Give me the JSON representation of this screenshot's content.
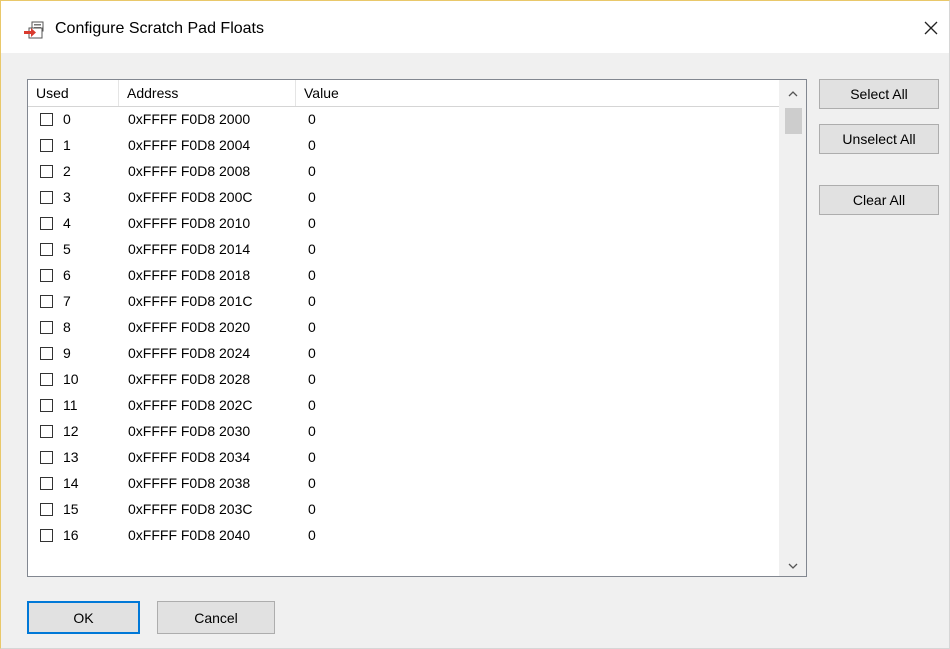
{
  "window": {
    "title": "Configure Scratch Pad Floats",
    "icon": "scratch-pad-icon",
    "close_label": "×"
  },
  "table": {
    "columns": [
      "Used",
      "Address",
      "Value"
    ],
    "rows": [
      {
        "index": "0",
        "address": "0xFFFF F0D8 2000",
        "value": "0",
        "checked": false
      },
      {
        "index": "1",
        "address": "0xFFFF F0D8 2004",
        "value": "0",
        "checked": false
      },
      {
        "index": "2",
        "address": "0xFFFF F0D8 2008",
        "value": "0",
        "checked": false
      },
      {
        "index": "3",
        "address": "0xFFFF F0D8 200C",
        "value": "0",
        "checked": false
      },
      {
        "index": "4",
        "address": "0xFFFF F0D8 2010",
        "value": "0",
        "checked": false
      },
      {
        "index": "5",
        "address": "0xFFFF F0D8 2014",
        "value": "0",
        "checked": false
      },
      {
        "index": "6",
        "address": "0xFFFF F0D8 2018",
        "value": "0",
        "checked": false
      },
      {
        "index": "7",
        "address": "0xFFFF F0D8 201C",
        "value": "0",
        "checked": false
      },
      {
        "index": "8",
        "address": "0xFFFF F0D8 2020",
        "value": "0",
        "checked": false
      },
      {
        "index": "9",
        "address": "0xFFFF F0D8 2024",
        "value": "0",
        "checked": false
      },
      {
        "index": "10",
        "address": "0xFFFF F0D8 2028",
        "value": "0",
        "checked": false
      },
      {
        "index": "11",
        "address": "0xFFFF F0D8 202C",
        "value": "0",
        "checked": false
      },
      {
        "index": "12",
        "address": "0xFFFF F0D8 2030",
        "value": "0",
        "checked": false
      },
      {
        "index": "13",
        "address": "0xFFFF F0D8 2034",
        "value": "0",
        "checked": false
      },
      {
        "index": "14",
        "address": "0xFFFF F0D8 2038",
        "value": "0",
        "checked": false
      },
      {
        "index": "15",
        "address": "0xFFFF F0D8 203C",
        "value": "0",
        "checked": false
      },
      {
        "index": "16",
        "address": "0xFFFF F0D8 2040",
        "value": "0",
        "checked": false
      }
    ]
  },
  "buttons": {
    "select_all": "Select All",
    "unselect_all": "Unselect All",
    "clear_all": "Clear All",
    "ok": "OK",
    "cancel": "Cancel"
  },
  "colors": {
    "accent": "#0078d7",
    "icon_red": "#d93a2e"
  }
}
